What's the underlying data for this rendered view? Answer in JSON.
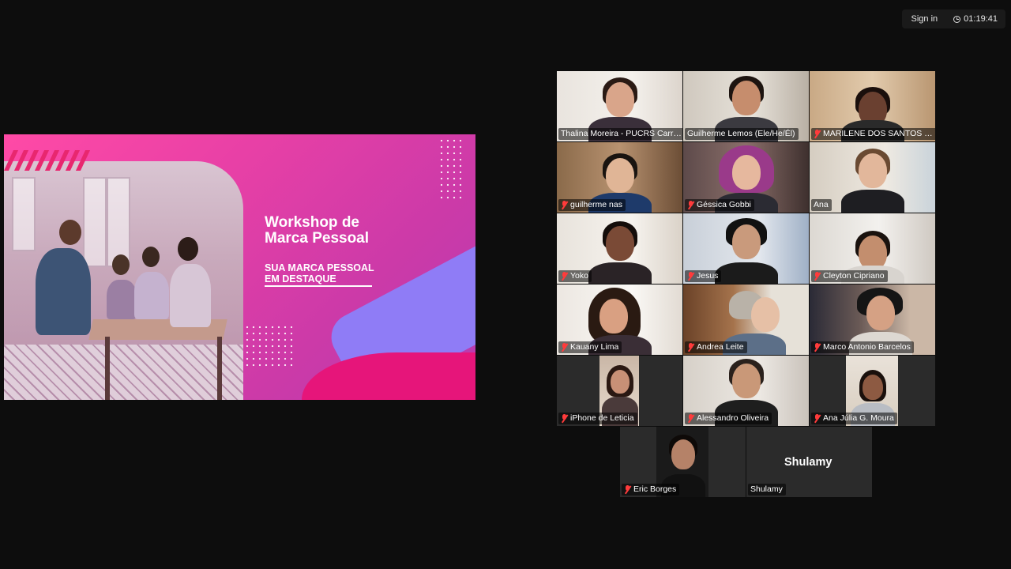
{
  "topbar": {
    "signin_label": "Sign in",
    "timer": "01:19:41"
  },
  "slide": {
    "title_line1": "Workshop de",
    "title_line2": "Marca Pessoal",
    "subtitle_line1": "SUA MARCA PESSOAL",
    "subtitle_line2": "EM DESTAQUE"
  },
  "participants": [
    {
      "name": "Thalina Moreira - PUCRS Carrei…",
      "muted": false,
      "active": false
    },
    {
      "name": "Guilherme Lemos (Ele/He/Él)",
      "muted": false,
      "active": true
    },
    {
      "name": "MARILENE DOS SANTOS REIS",
      "muted": true,
      "active": false
    },
    {
      "name": "guilherme nas",
      "muted": true,
      "active": false
    },
    {
      "name": "Géssica Gobbi",
      "muted": true,
      "active": false
    },
    {
      "name": "Ana",
      "muted": false,
      "active": false
    },
    {
      "name": "Yoko",
      "muted": true,
      "active": false
    },
    {
      "name": "Jesus",
      "muted": true,
      "active": false
    },
    {
      "name": "Cleyton Cipriano",
      "muted": true,
      "active": false
    },
    {
      "name": "Kauany Lima",
      "muted": true,
      "active": false
    },
    {
      "name": "Andrea Leite",
      "muted": true,
      "active": false
    },
    {
      "name": "Marco Antonio Barcelos",
      "muted": true,
      "active": false
    },
    {
      "name": "iPhone de Leticia",
      "muted": true,
      "active": false
    },
    {
      "name": "Alessandro Oliveira",
      "muted": true,
      "active": false
    },
    {
      "name": "Ana Júlia G. Moura",
      "muted": true,
      "active": false
    },
    {
      "name": "Eric Borges",
      "muted": true,
      "active": false
    },
    {
      "name": "Shulamy",
      "muted": false,
      "active": false,
      "display_name": "Shulamy"
    }
  ],
  "colors": {
    "active_speaker": "#26e27e",
    "muted_icon": "#ff3b3b",
    "slide_pink": "#ff4aa6",
    "slide_accent": "#8f7cf6"
  }
}
